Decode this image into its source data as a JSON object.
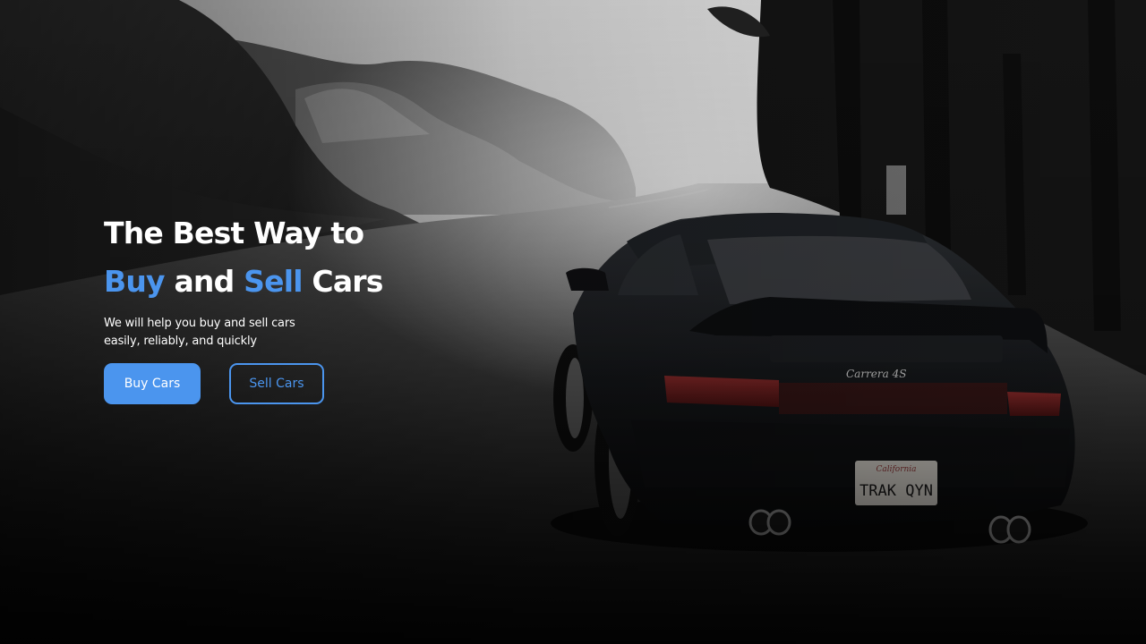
{
  "hero": {
    "headline": {
      "line1": "The Best Way to",
      "buy": "Buy",
      "and": " and ",
      "sell": "Sell",
      "cars": " Cars"
    },
    "subtitle": "We will help you buy and sell cars easily, reliably, and quickly",
    "buttons": {
      "buy_label": "Buy Cars",
      "sell_label": "Sell Cars"
    },
    "background": {
      "plate_state": "California",
      "plate_number": "TRAK QYN",
      "badge": "Carrera 4S"
    }
  },
  "colors": {
    "accent": "#4b95ee",
    "text": "#ffffff"
  }
}
